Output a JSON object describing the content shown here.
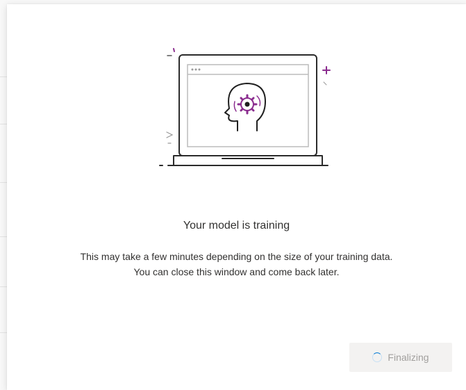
{
  "dialog": {
    "title": "Your model is training",
    "description_line1": "This may take a few minutes depending on the size of your training data.",
    "description_line2": "You can close this window and come back later.",
    "finalize_button_label": "Finalizing",
    "finalize_button_disabled": true
  },
  "illustration": {
    "name": "laptop-brain-gear-illustration",
    "accent_color": "#8b2d8f"
  },
  "icons": {
    "spinner": "loading-spinner-icon"
  },
  "colors": {
    "text": "#323130",
    "disabled_text": "#a19f9d",
    "disabled_button_bg": "#f3f2f1",
    "spinner_accent": "#0078d4"
  }
}
